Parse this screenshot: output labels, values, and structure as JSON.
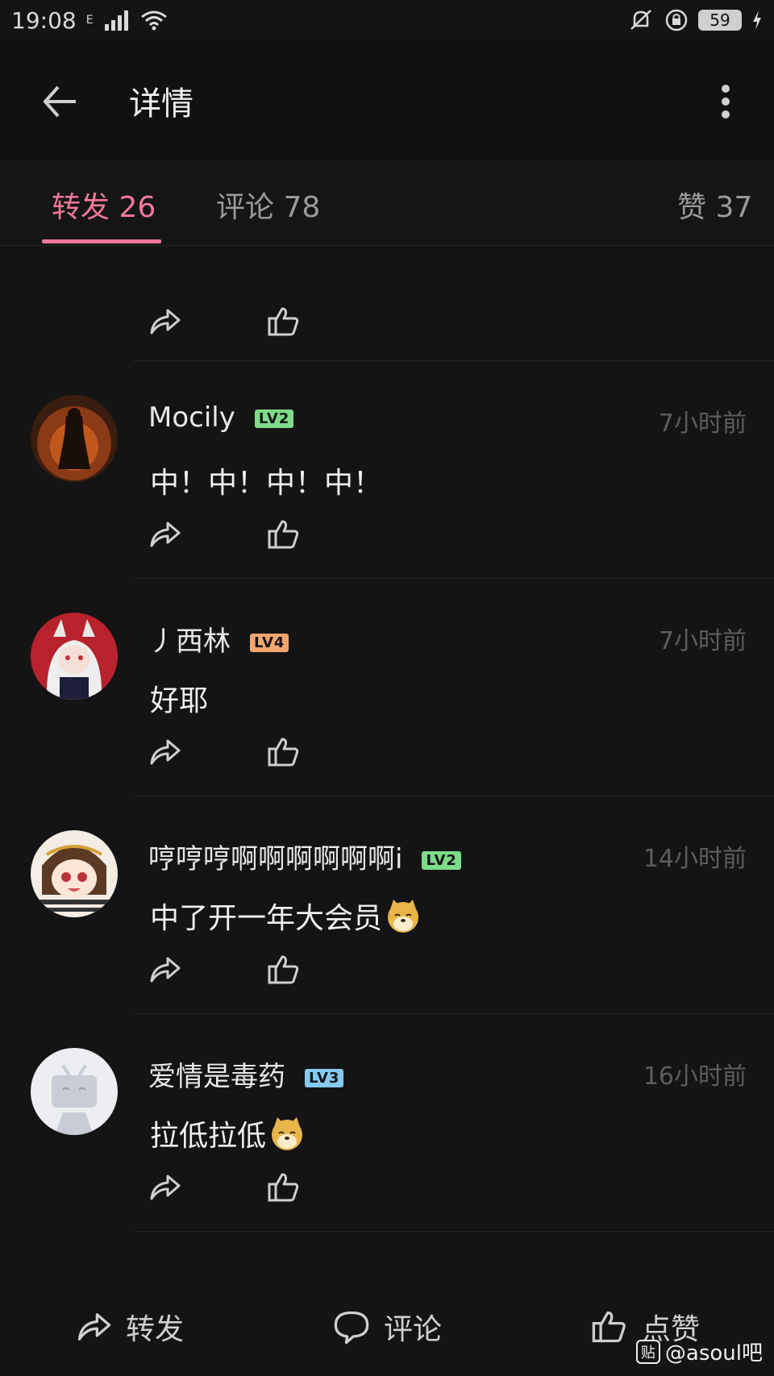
{
  "status_bar": {
    "time": "19:08",
    "network": "E",
    "battery": "59"
  },
  "app_bar": {
    "title": "详情"
  },
  "tabs": [
    {
      "label": "转发 26",
      "active": true
    },
    {
      "label": "评论 78",
      "active": false
    },
    {
      "label": "赞 37",
      "active": false
    }
  ],
  "comments": [
    {
      "name": "Mocily",
      "level": "LV2",
      "level_color": "#7ddc8a",
      "time": "7小时前",
      "text": "中！中！中！中！",
      "emoji": false
    },
    {
      "name": "丿西林",
      "level": "LV4",
      "level_color": "#f3a66d",
      "time": "7小时前",
      "text": "好耶",
      "emoji": false
    },
    {
      "name": "哼哼哼啊啊啊啊啊啊i",
      "level": "LV2",
      "level_color": "#7ddc8a",
      "time": "14小时前",
      "text": "中了开一年大会员",
      "emoji": true
    },
    {
      "name": "爱情是毒药",
      "level": "LV3",
      "level_color": "#84c9f0",
      "time": "16小时前",
      "text": "拉低拉低",
      "emoji": true
    }
  ],
  "bottom_bar": {
    "repost": "转发",
    "comment": "评论",
    "like": "点赞"
  },
  "watermark": {
    "text": "@asoul吧",
    "badge": "贴"
  },
  "colors": {
    "accent": "#f1789b",
    "background": "#141414"
  }
}
